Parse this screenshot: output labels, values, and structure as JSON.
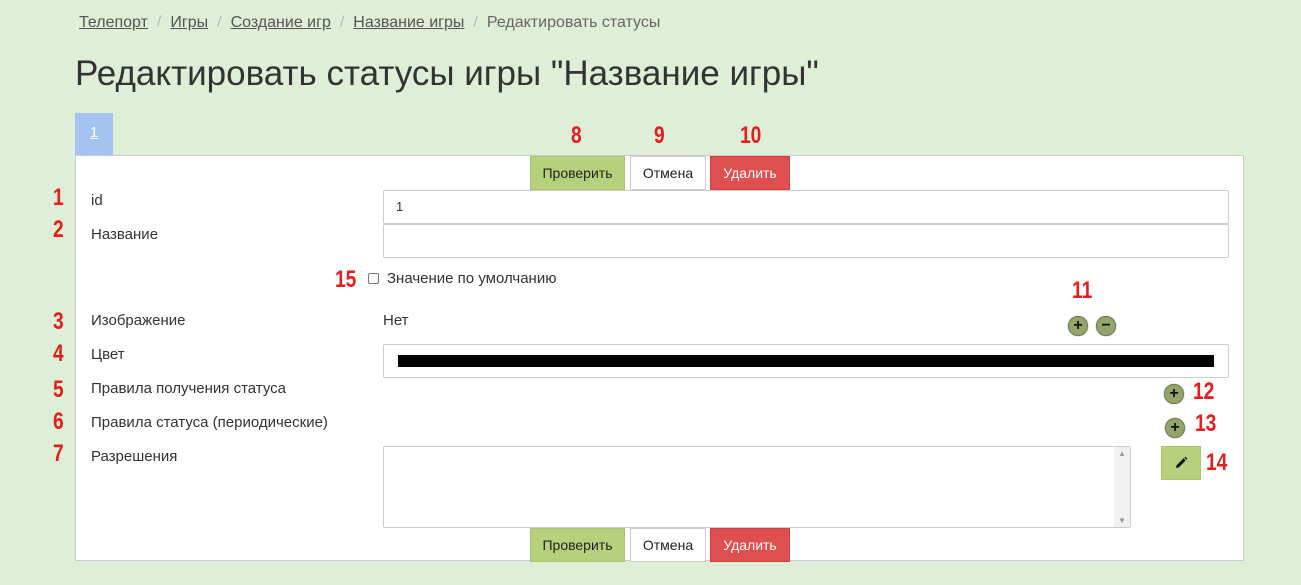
{
  "breadcrumb": {
    "items": [
      "Телепорт",
      "Игры",
      "Создание игр",
      "Название игры"
    ],
    "current": "Редактировать статусы"
  },
  "page_title": "Редактировать статусы игры \"Название игры\"",
  "tabs": [
    {
      "label": "1",
      "active": true
    }
  ],
  "actions": {
    "check": "Проверить",
    "cancel": "Отмена",
    "delete": "Удалить"
  },
  "form": {
    "id_label": "id",
    "id_value": "1",
    "name_label": "Название",
    "name_value": "",
    "default_checkbox_label": "Значение по умолчанию",
    "default_checked": false,
    "image_label": "Изображение",
    "image_value": "Нет",
    "color_label": "Цвет",
    "color_value": "#000000",
    "rules_get_label": "Правила получения статуса",
    "rules_periodic_label": "Правила статуса (периодические)",
    "permissions_label": "Разрешения",
    "permissions_value": ""
  },
  "annotations": [
    "1",
    "2",
    "3",
    "4",
    "5",
    "6",
    "7",
    "8",
    "9",
    "10",
    "11",
    "12",
    "13",
    "14",
    "15"
  ],
  "icons": {
    "add": "plus-icon",
    "remove": "minus-icon",
    "edit": "pencil-icon"
  },
  "colors": {
    "background": "#dfeed6",
    "check_button": "#b6d07c",
    "delete_button": "#df4f4f",
    "tab_active": "#a5c3f2",
    "annotation": "#e41d1d",
    "round_button": "#92a56b"
  }
}
